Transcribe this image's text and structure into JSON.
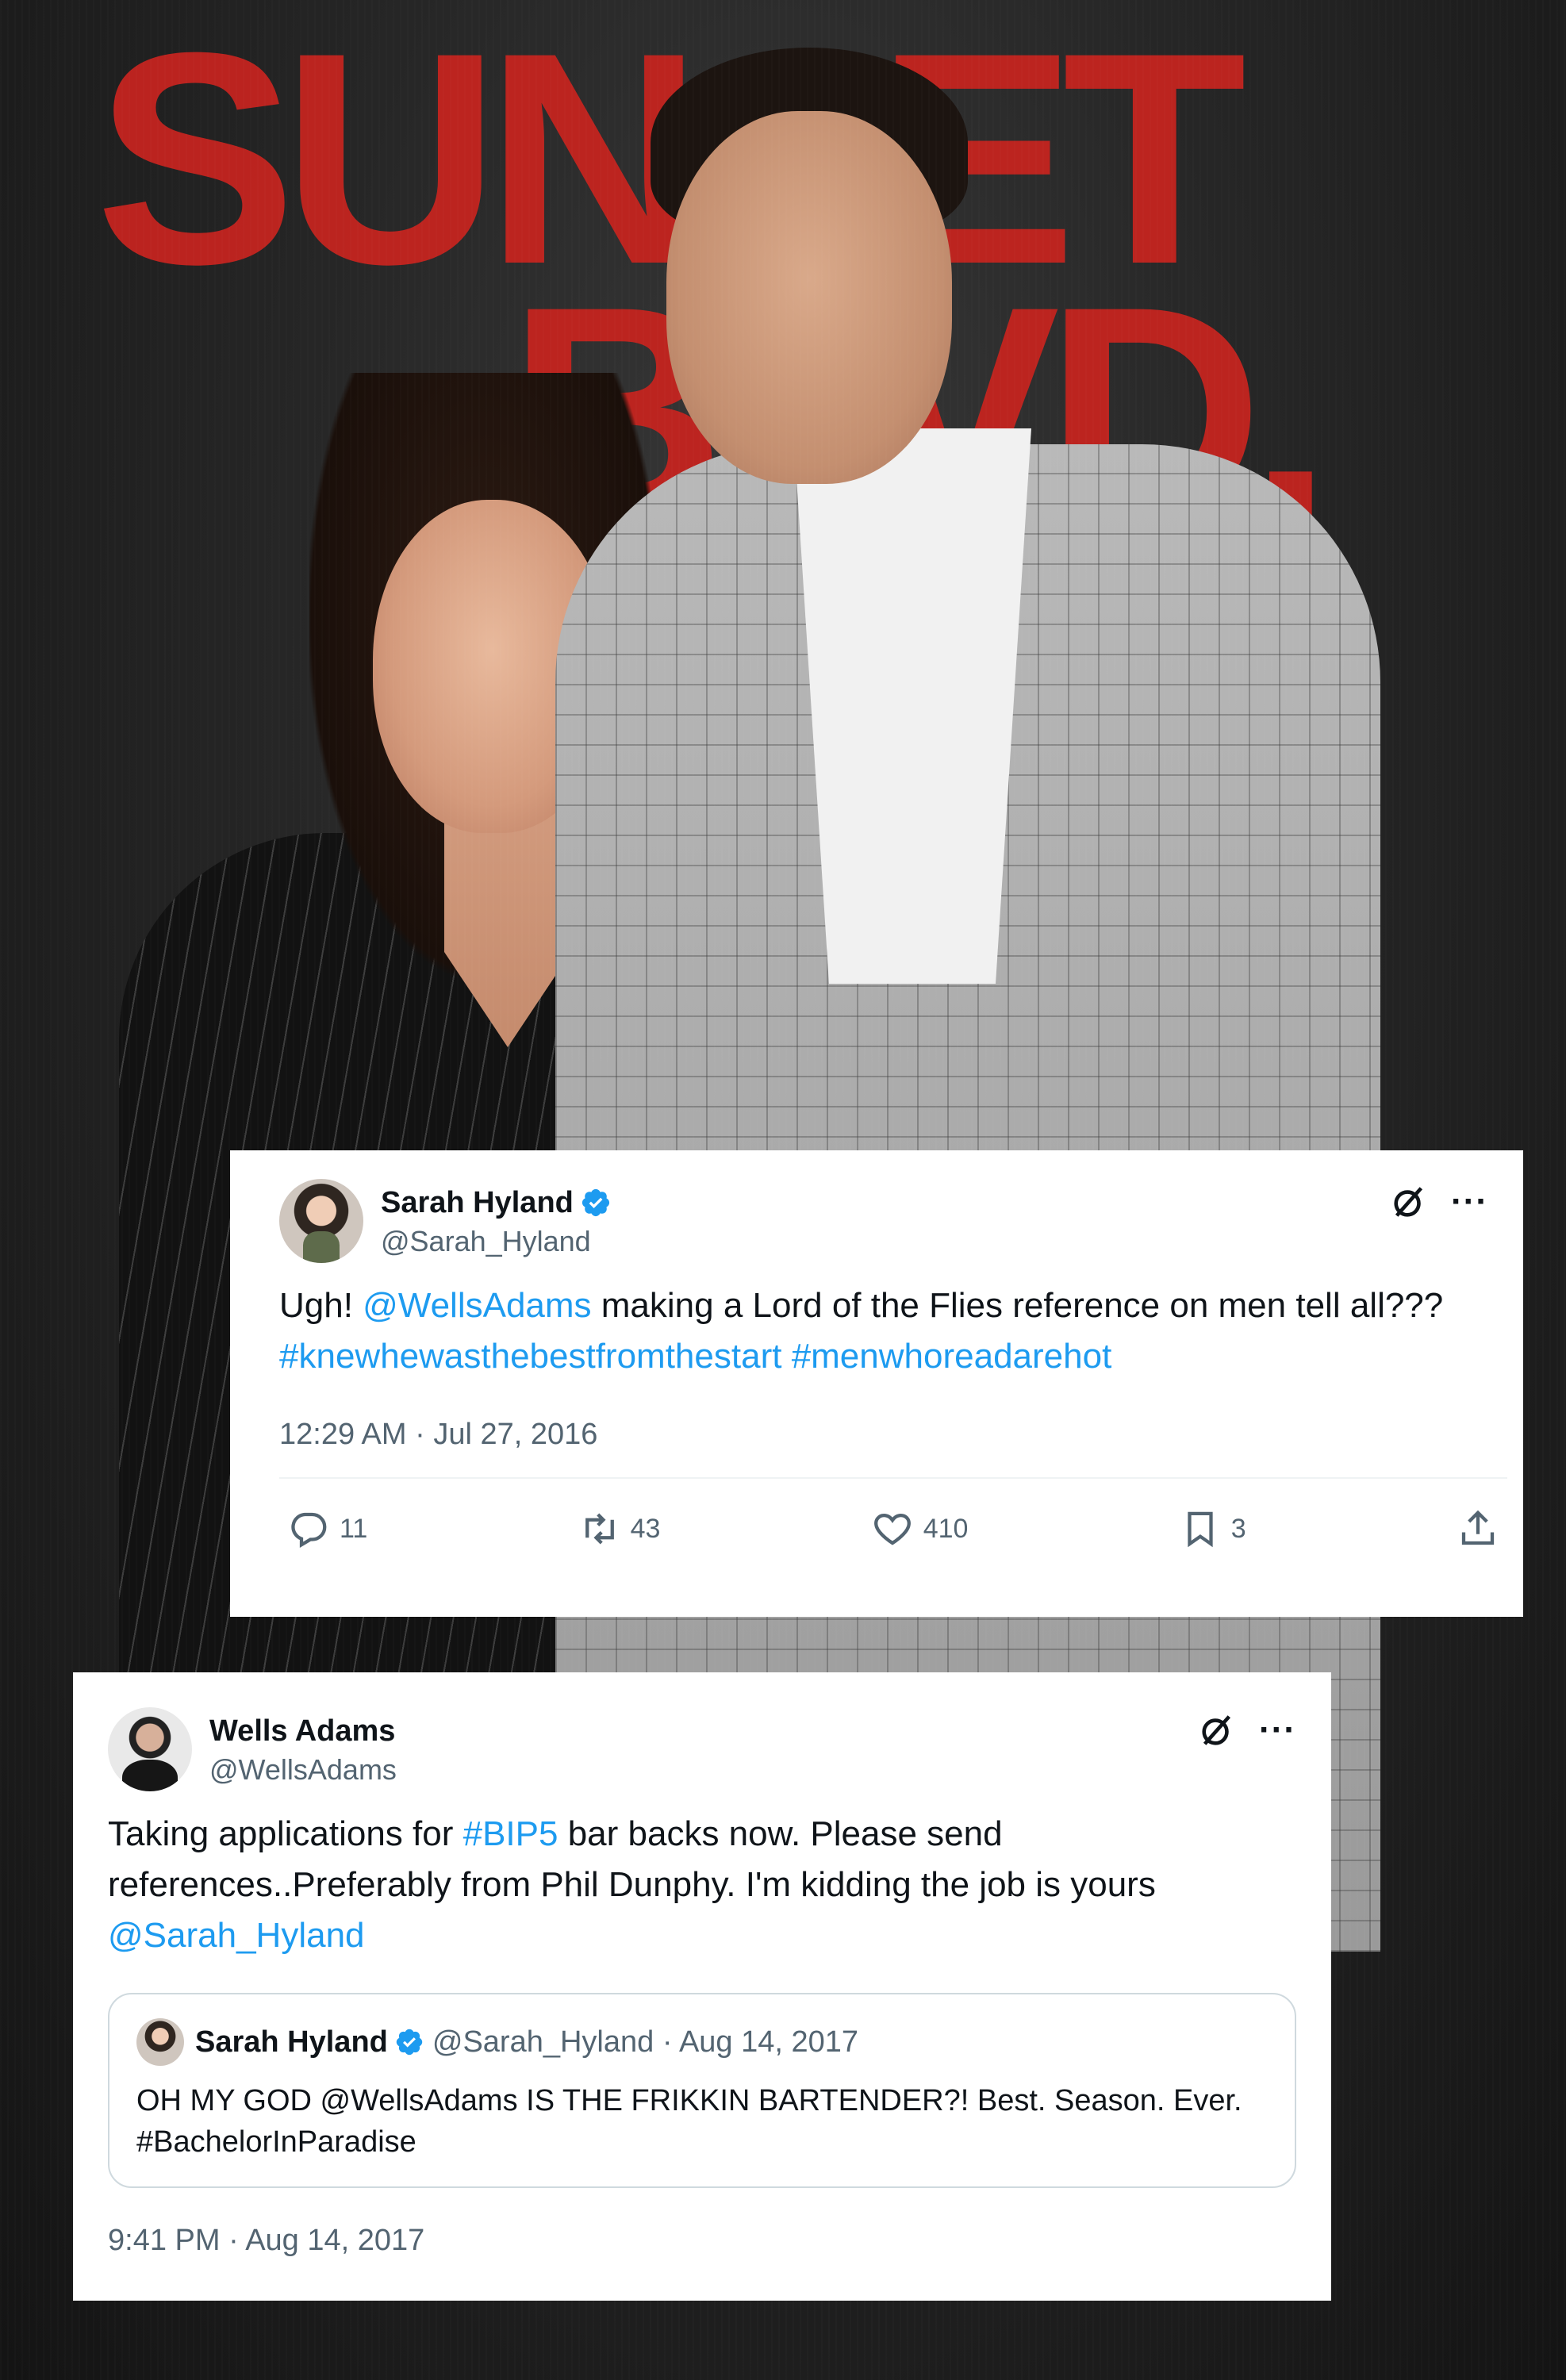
{
  "background": {
    "sign_line1": "SUNSET",
    "sign_line2": "BLVD."
  },
  "tweet1": {
    "display_name": "Sarah Hyland",
    "handle": "@Sarah_Hyland",
    "text_parts": {
      "p1": "Ugh! ",
      "m1": "@WellsAdams",
      "p2": " making a Lord of the Flies reference on men tell all??? ",
      "h1": "#knewhewasthebestfromthestart",
      "p3": " ",
      "h2": "#menwhoreadarehot"
    },
    "timestamp": "12:29 AM · Jul 27, 2016",
    "replies": "11",
    "reposts": "43",
    "likes": "410",
    "bookmarks": "3",
    "icons": [
      "verified-badge-icon",
      "grok-icon",
      "more-icon",
      "reply-icon",
      "repost-icon",
      "like-icon",
      "bookmark-icon",
      "share-icon"
    ],
    "accent_color": "#1d9bf0"
  },
  "tweet2": {
    "display_name": "Wells Adams",
    "handle": "@WellsAdams",
    "text_parts": {
      "p1": "Taking applications for ",
      "h1": "#BIP5",
      "p2": " bar backs now. Please send references..Preferably from Phil Dunphy. I'm kidding the job is yours ",
      "m1": "@Sarah_Hyland"
    },
    "timestamp": "9:41 PM · Aug 14, 2017",
    "quote": {
      "display_name": "Sarah Hyland",
      "handle_date": "@Sarah_Hyland · Aug 14, 2017",
      "text": "OH MY GOD @WellsAdams IS THE FRIKKIN BARTENDER?! Best. Season. Ever. #BachelorInParadise"
    }
  }
}
